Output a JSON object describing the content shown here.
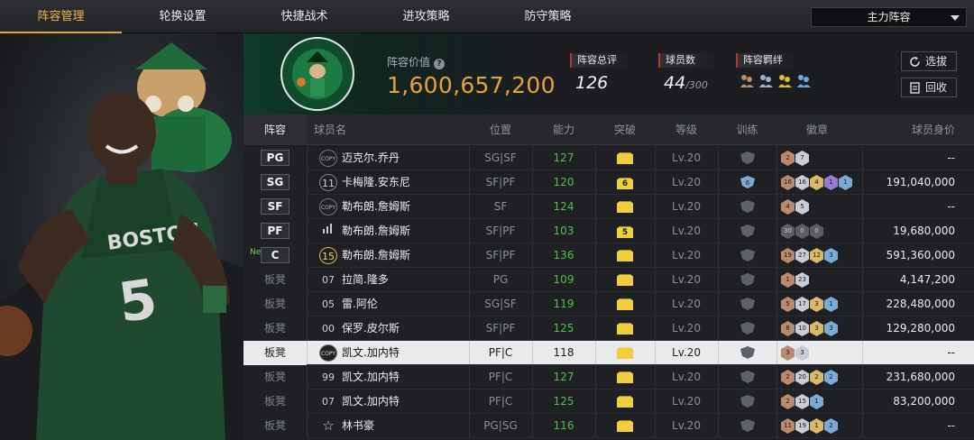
{
  "tabs": [
    {
      "label": "阵容管理",
      "active": true
    },
    {
      "label": "轮换设置",
      "active": false
    },
    {
      "label": "快捷战术",
      "active": false
    },
    {
      "label": "进攻策略",
      "active": false
    },
    {
      "label": "防守策略",
      "active": false
    }
  ],
  "lineup_select": {
    "value": "主力阵容"
  },
  "header": {
    "team_logo_text": "BOSTON CELTICS",
    "value_label": "阵容价值",
    "value": "1,600,657,200",
    "overall_label": "阵容总评",
    "overall_value": "126",
    "players_label": "球员数",
    "players_value": "44",
    "players_max": "/300",
    "bond_label": "阵容羁绊",
    "scout_button": "选拔",
    "recycle_button": "回收"
  },
  "table": {
    "columns": [
      "阵容",
      "球员名",
      "位置",
      "能力",
      "突破",
      "等级",
      "训练",
      "徽章",
      "球员身价"
    ],
    "rows": [
      {
        "slot": "PG",
        "starter": true,
        "new": false,
        "jersey": "COPY",
        "name": "迈克尔.乔丹",
        "position": "SG|SF",
        "ability": "127",
        "breakthrough": "",
        "level": "Lv.20",
        "training": "",
        "badges": [
          [
            "2",
            "bronze"
          ],
          [
            "7",
            "silver"
          ]
        ],
        "value": "--",
        "selected": false
      },
      {
        "slot": "SG",
        "starter": true,
        "new": false,
        "jersey": "11",
        "name": "卡梅隆.安东尼",
        "position": "SF|PF",
        "ability": "120",
        "breakthrough": "6",
        "level": "Lv.20",
        "training": "6",
        "badges": [
          [
            "16",
            "bronze"
          ],
          [
            "16",
            "silver"
          ],
          [
            "4",
            "gold"
          ],
          [
            "1",
            "purple"
          ],
          [
            "1",
            "blue"
          ]
        ],
        "value": "191,040,000",
        "selected": false
      },
      {
        "slot": "SF",
        "starter": true,
        "new": false,
        "jersey": "COPY",
        "name": "勒布朗.詹姆斯",
        "position": "SF",
        "ability": "124",
        "breakthrough": "",
        "level": "Lv.20",
        "training": "",
        "badges": [
          [
            "4",
            "bronze"
          ],
          [
            "5",
            "silver"
          ]
        ],
        "value": "--",
        "selected": false
      },
      {
        "slot": "PF",
        "starter": true,
        "new": false,
        "jersey": "ill",
        "name": "勒布朗.詹姆斯",
        "position": "SF|PF",
        "ability": "103",
        "breakthrough": "5",
        "level": "Lv.20",
        "training": "",
        "badges": [
          [
            "30",
            "dark"
          ],
          [
            "0",
            "dark"
          ],
          [
            "0",
            "dark"
          ]
        ],
        "value": "19,680,000",
        "selected": false
      },
      {
        "slot": "C",
        "starter": true,
        "new": true,
        "new_label": "New",
        "jersey": "15",
        "name": "勒布朗.詹姆斯",
        "position": "SF|PF",
        "ability": "136",
        "breakthrough": "",
        "level": "Lv.20",
        "training": "",
        "badges": [
          [
            "19",
            "bronze"
          ],
          [
            "27",
            "silver"
          ],
          [
            "12",
            "gold"
          ],
          [
            "3",
            "blue"
          ]
        ],
        "value": "591,360,000",
        "selected": false
      },
      {
        "slot": "板凳",
        "starter": false,
        "new": false,
        "jersey": "07",
        "name": "拉简.隆多",
        "position": "PG",
        "ability": "109",
        "breakthrough": "",
        "level": "Lv.20",
        "training": "",
        "badges": [
          [
            "1",
            "bronze"
          ],
          [
            "23",
            "silver"
          ]
        ],
        "value": "4,147,200",
        "selected": false
      },
      {
        "slot": "板凳",
        "starter": false,
        "new": false,
        "jersey": "05",
        "name": "雷.阿伦",
        "position": "SG|SF",
        "ability": "119",
        "breakthrough": "",
        "level": "Lv.20",
        "training": "",
        "badges": [
          [
            "5",
            "bronze"
          ],
          [
            "17",
            "silver"
          ],
          [
            "3",
            "gold"
          ],
          [
            "1",
            "blue"
          ]
        ],
        "value": "228,480,000",
        "selected": false
      },
      {
        "slot": "板凳",
        "starter": false,
        "new": false,
        "jersey": "00",
        "name": "保罗.皮尔斯",
        "position": "SF|PF",
        "ability": "125",
        "breakthrough": "",
        "level": "Lv.20",
        "training": "",
        "badges": [
          [
            "8",
            "bronze"
          ],
          [
            "10",
            "silver"
          ],
          [
            "3",
            "gold"
          ],
          [
            "3",
            "blue"
          ]
        ],
        "value": "129,280,000",
        "selected": false
      },
      {
        "slot": "板凳",
        "starter": false,
        "new": false,
        "jersey": "COPY",
        "name": "凯文.加内特",
        "position": "PF|C",
        "ability": "118",
        "breakthrough": "",
        "level": "Lv.20",
        "training": "",
        "badges": [
          [
            "3",
            "bronze"
          ],
          [
            "3",
            "silver"
          ]
        ],
        "value": "--",
        "selected": true
      },
      {
        "slot": "板凳",
        "starter": false,
        "new": false,
        "jersey": "99",
        "name": "凯文.加内特",
        "position": "PF|C",
        "ability": "127",
        "breakthrough": "",
        "level": "Lv.20",
        "training": "",
        "badges": [
          [
            "2",
            "bronze"
          ],
          [
            "20",
            "silver"
          ],
          [
            "2",
            "gold"
          ],
          [
            "2",
            "blue"
          ]
        ],
        "value": "231,680,000",
        "selected": false
      },
      {
        "slot": "板凳",
        "starter": false,
        "new": false,
        "jersey": "07",
        "name": "凯文.加内特",
        "position": "PF|C",
        "ability": "125",
        "breakthrough": "",
        "level": "Lv.20",
        "training": "",
        "badges": [
          [
            "2",
            "bronze"
          ],
          [
            "15",
            "silver"
          ],
          [
            "1",
            "blue"
          ]
        ],
        "value": "83,200,000",
        "selected": false
      },
      {
        "slot": "板凳",
        "starter": false,
        "new": false,
        "jersey": "star",
        "name": "林书豪",
        "position": "PG|SG",
        "ability": "116",
        "breakthrough": "",
        "level": "Lv.20",
        "training": "",
        "badges": [
          [
            "11",
            "bronze"
          ],
          [
            "19",
            "silver"
          ],
          [
            "1",
            "gold"
          ],
          [
            "2",
            "blue"
          ]
        ],
        "value": "--",
        "selected": false
      }
    ]
  },
  "colors": {
    "accent": "#e6a23b",
    "ability": "#4fc14a",
    "selected_row": "#e9eaeb",
    "breakthrough": "#f1cf3c"
  }
}
